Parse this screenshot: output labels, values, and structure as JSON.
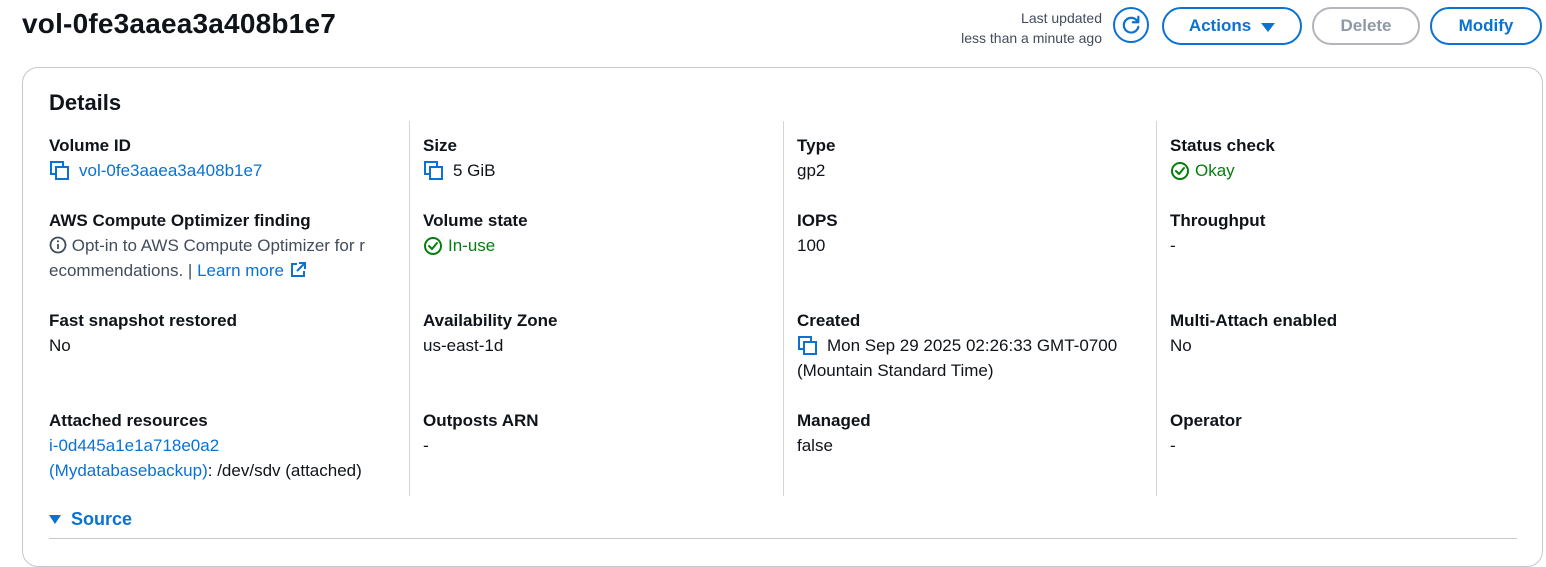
{
  "header": {
    "title": "vol-0fe3aaea3a408b1e7",
    "last_updated_label": "Last updated",
    "last_updated_value": "less than a minute ago",
    "actions_label": "Actions",
    "delete_label": "Delete",
    "modify_label": "Modify"
  },
  "details": {
    "title": "Details",
    "volume_id_label": "Volume ID",
    "volume_id_value": "vol-0fe3aaea3a408b1e7",
    "size_label": "Size",
    "size_value": "5 GiB",
    "type_label": "Type",
    "type_value": "gp2",
    "status_check_label": "Status check",
    "status_check_value": "Okay",
    "optimizer_label": "AWS Compute Optimizer finding",
    "optimizer_value_line1": "Opt-in to AWS Compute Optimizer for r",
    "optimizer_value_line2": "ecommendations. |",
    "learn_more": "Learn more",
    "volume_state_label": "Volume state",
    "volume_state_value": "In-use",
    "iops_label": "IOPS",
    "iops_value": "100",
    "throughput_label": "Throughput",
    "throughput_value": "-",
    "fast_snapshot_label": "Fast snapshot restored",
    "fast_snapshot_value": "No",
    "az_label": "Availability Zone",
    "az_value": "us-east-1d",
    "created_label": "Created",
    "created_value_line1": "Mon Sep 29 2025 02:26:33 GMT-0700",
    "created_value_line2": "(Mountain Standard Time)",
    "multi_attach_label": "Multi-Attach enabled",
    "multi_attach_value": "No",
    "attached_label": "Attached resources",
    "attached_instance": "i-0d445a1e1a718e0a2",
    "attached_instance_name": "(Mydatabasebackup)",
    "attached_suffix": ": /dev/sdv (attached)",
    "outposts_label": "Outposts ARN",
    "outposts_value": "-",
    "managed_label": "Managed",
    "managed_value": "false",
    "operator_label": "Operator",
    "operator_value": "-",
    "source_label": "Source"
  },
  "colors": {
    "link": "#0972d3",
    "success": "#037f0c",
    "disabled": "#8d99a8"
  }
}
